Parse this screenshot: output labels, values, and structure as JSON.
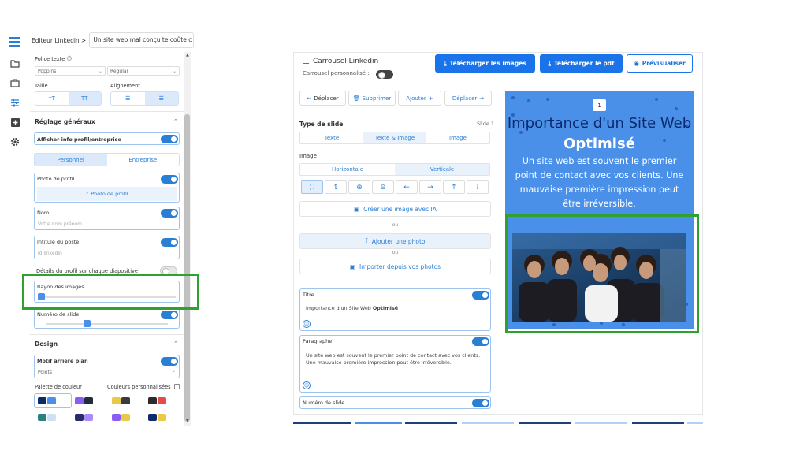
{
  "topbar": {
    "breadcrumb": "Editeur Linkedin >",
    "title_value": "Un site web mal conçu te coûte c"
  },
  "rail": [
    "menu-icon",
    "folder-icon",
    "briefcase-icon",
    "sliders-icon",
    "plus-square-icon",
    "gear-icon"
  ],
  "sidebar": {
    "police_label": "Police texte",
    "font_value": "Poppins",
    "weight_value": "Regular",
    "taille_label": "Taille",
    "alignement_label": "Alignement",
    "section_general": "Réglage généraux",
    "show_profile_label": "Afficher info profil/entreprise",
    "personnel": "Personnel",
    "entreprise": "Entreprise",
    "photo_profil_label": "Photo de profil",
    "photo_profil_button": "Photo de profil",
    "nom_label": "Nom",
    "nom_placeholder": "Votre nom prénom",
    "poste_label": "Intitulé du poste",
    "poste_placeholder": "Id linkedin",
    "details_label": "Détails du profil sur chaque diapositive",
    "rayon_label": "Rayon des images",
    "rayon_value": 0.0,
    "numero_label": "Numéro de slide",
    "numero_value": 0.33,
    "section_design": "Design",
    "motif_label": "Motif arrière plan",
    "motif_value": "Points",
    "palette_label": "Palette de couleur",
    "custom_colors_label": "Couleurs personnalisées"
  },
  "palettes": [
    [
      "#0d2b6b",
      "#4a90e8"
    ],
    [
      "#8b5cf6",
      "#222b3a"
    ],
    [
      "#e8c94a",
      "#3b3b3b"
    ],
    [
      "#2b2b2b",
      "#e84a4a"
    ],
    [
      "#2a7f7f",
      "#cfe0f5"
    ],
    [
      "#2b2b6b",
      "#a78bfa"
    ],
    [
      "#8b5cf6",
      "#e8c94a"
    ],
    [
      "#0d2b6b",
      "#e8c94a"
    ]
  ],
  "toolbar": {
    "title": "Carrousel Linkedin",
    "custom_label": "Carrousel personnalisé :",
    "download_images": "Télécharger les images",
    "download_pdf": "Télécharger le pdf",
    "preview": "Prévisualiser"
  },
  "editor": {
    "move_left": "Déplacer",
    "delete": "Supprimer",
    "add": "Ajouter",
    "move_right": "Déplacer",
    "type_label": "Type de slide",
    "slide_label": "Slide 1",
    "tab_texte": "Texte",
    "tab_texte_image": "Texte & Image",
    "tab_image": "Image",
    "image_label": "Image",
    "horizontale": "Horizontale",
    "verticale": "Verticale",
    "create_ai": "Créer une image avec IA",
    "ou1": "ou",
    "add_photo": "Ajouter une photo",
    "ou2": "ou",
    "import_photos": "Importer depuis vos photos",
    "titre_label": "Titre",
    "titre_value_a": "Importance d'un Site Web ",
    "titre_value_b": "Optimisé",
    "paragraphe_label": "Paragraphe",
    "paragraphe_value": "Un site web est souvent le premier point de contact avec vos clients. Une mauvaise première impression peut être irréversible.",
    "numero_label": "Numéro de slide"
  },
  "slide": {
    "number": "1",
    "title_a": "Importance d'un Site Web ",
    "title_b": "Optimisé",
    "paragraph": "Un site web est souvent le premier point de contact avec vos clients. Une mauvaise première impression peut être irréversible.",
    "background": "#4a90e8",
    "title_color": "#0b2a6e"
  },
  "highlight_color": "#2ea12e"
}
